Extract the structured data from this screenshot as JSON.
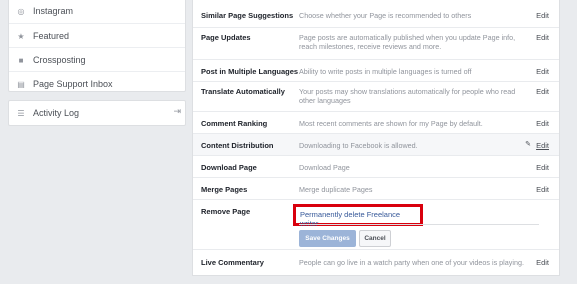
{
  "sidebar": {
    "items": [
      {
        "label": "Instagram",
        "icon": "instagram-icon"
      },
      {
        "label": "Featured",
        "icon": "star-icon"
      },
      {
        "label": "Crossposting",
        "icon": "video-camera-icon"
      },
      {
        "label": "Page Support Inbox",
        "icon": "inbox-icon"
      }
    ],
    "activity_log": {
      "label": "Activity Log",
      "icon": "list-icon"
    }
  },
  "settings": {
    "rows": [
      {
        "label": "Similar Page Suggestions",
        "desc": "Choose whether your Page is recommended to others",
        "edit": "Edit"
      },
      {
        "label": "Page Updates",
        "desc": "Page posts are automatically published when you update Page info, reach milestones, receive reviews and more.",
        "edit": "Edit"
      },
      {
        "label": "Post in Multiple Languages",
        "desc": "Ability to write posts in multiple languages is turned off",
        "edit": "Edit"
      },
      {
        "label": "Translate Automatically",
        "desc": "Your posts may show translations automatically for people who read other languages",
        "edit": "Edit"
      },
      {
        "label": "Comment Ranking",
        "desc": "Most recent comments are shown for my Page by default.",
        "edit": "Edit"
      },
      {
        "label": "Content Distribution",
        "desc": "Downloading to Facebook is allowed.",
        "edit": "Edit"
      },
      {
        "label": "Download Page",
        "desc": "Download Page",
        "edit": "Edit"
      },
      {
        "label": "Merge Pages",
        "desc": "Merge duplicate Pages",
        "edit": "Edit"
      }
    ],
    "remove_page": {
      "label": "Remove Page",
      "delete_link": "Permanently delete Freelance writer",
      "save_button": "Save Changes",
      "cancel_button": "Cancel"
    },
    "live_commentary": {
      "label": "Live Commentary",
      "desc": "People can go live in a watch party when one of your videos is playing.",
      "edit": "Edit"
    }
  },
  "colors": {
    "highlight_border": "#d9000d",
    "link": "#365899"
  }
}
